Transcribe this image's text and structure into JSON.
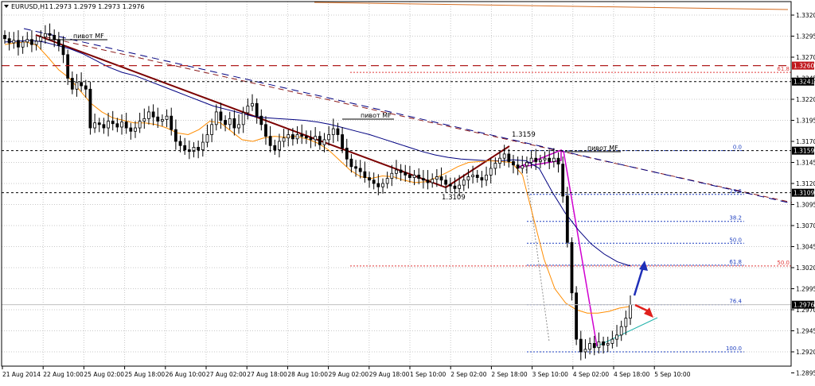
{
  "header": {
    "symbol_label": "EURUSD,H1",
    "ohlc_label": "1.2973 1.2979 1.2973 1.2976"
  },
  "chart_data": {
    "type": "candlestick",
    "symbol": "EURUSD",
    "timeframe": "H1",
    "ohlc_last": {
      "open": 1.2973,
      "high": 1.2979,
      "low": 1.2973,
      "close": 1.2976
    },
    "ylim": [
      1.2895,
      1.3323
    ],
    "grid": true,
    "price_ticks": [
      "1.3320",
      "1.3295",
      "1.3270",
      "1.3245",
      "1.3220",
      "1.3195",
      "1.3170",
      "1.3145",
      "1.3120",
      "1.3095",
      "1.3070",
      "1.3045",
      "1.3020",
      "1.2995",
      "1.2970",
      "1.2945",
      "1.2920",
      "1.2895"
    ],
    "time_ticks": [
      "21 Aug 2014",
      "22 Aug 10:00",
      "25 Aug 02:00",
      "25 Aug 18:00",
      "26 Aug 10:00",
      "27 Aug 02:00",
      "27 Aug 18:00",
      "28 Aug 10:00",
      "29 Aug 02:00",
      "29 Aug 18:00",
      "1 Sep 10:00",
      "2 Sep 02:00",
      "2 Sep 18:00",
      "3 Sep 10:00",
      "4 Sep 02:00",
      "4 Sep 18:00",
      "5 Sep 10:00"
    ],
    "closes": [
      1.3292,
      1.3287,
      1.329,
      1.3282,
      1.3288,
      1.3291,
      1.3285,
      1.3289,
      1.3294,
      1.3298,
      1.3296,
      1.3291,
      1.3284,
      1.3273,
      1.3245,
      1.3232,
      1.324,
      1.3236,
      1.3232,
      1.3186,
      1.3192,
      1.319,
      1.3186,
      1.3194,
      1.3191,
      1.3187,
      1.3193,
      1.3186,
      1.3182,
      1.3186,
      1.3194,
      1.3197,
      1.3205,
      1.3199,
      1.3194,
      1.3196,
      1.32,
      1.3184,
      1.317,
      1.3165,
      1.316,
      1.3158,
      1.3163,
      1.316,
      1.3169,
      1.3178,
      1.319,
      1.3205,
      1.3195,
      1.319,
      1.3197,
      1.3186,
      1.319,
      1.3204,
      1.3212,
      1.3215,
      1.32,
      1.319,
      1.3176,
      1.3165,
      1.316,
      1.317,
      1.3174,
      1.3178,
      1.3173,
      1.3178,
      1.3176,
      1.3174,
      1.3172,
      1.3176,
      1.3166,
      1.3172,
      1.3178,
      1.3185,
      1.3178,
      1.3162,
      1.3149,
      1.314,
      1.3138,
      1.3134,
      1.3127,
      1.3124,
      1.312,
      1.3116,
      1.312,
      1.3126,
      1.3132,
      1.3136,
      1.3133,
      1.313,
      1.3127,
      1.313,
      1.3126,
      1.3124,
      1.3121,
      1.3125,
      1.3128,
      1.3124,
      1.3119,
      1.3117,
      1.3114,
      1.3118,
      1.3124,
      1.3128,
      1.313,
      1.3127,
      1.3124,
      1.313,
      1.3138,
      1.3144,
      1.315,
      1.3155,
      1.3146,
      1.3142,
      1.3138,
      1.3141,
      1.3145,
      1.315,
      1.3146,
      1.3148,
      1.315,
      1.3146,
      1.315,
      1.3143,
      1.3105,
      1.305,
      1.299,
      1.2935,
      1.292,
      1.2923,
      1.293,
      1.2925,
      1.2932,
      1.2928,
      1.293,
      1.2935,
      1.294,
      1.295,
      1.296,
      1.2976
    ],
    "moving_averages": [
      {
        "color": "#000080",
        "values": [
          1.3288,
          1.3289,
          1.329,
          1.3288,
          1.3284,
          1.328,
          1.3274,
          1.3266,
          1.3258,
          1.3252,
          1.3248,
          1.3242,
          1.3236,
          1.323,
          1.3224,
          1.3218,
          1.3212,
          1.3208,
          1.3204,
          1.32,
          1.3198,
          1.3197,
          1.3196,
          1.3195,
          1.3193,
          1.319,
          1.3186,
          1.3182,
          1.3178,
          1.3173,
          1.3168,
          1.3163,
          1.3158,
          1.3154,
          1.3151,
          1.3149,
          1.3148,
          1.3147,
          1.3147,
          1.3148,
          1.3147,
          1.3138,
          1.311,
          1.3085,
          1.3065,
          1.3048,
          1.3036,
          1.3027,
          1.3022
        ]
      },
      {
        "color": "#ff8c00",
        "values": [
          1.3285,
          1.3287,
          1.3288,
          1.3284,
          1.327,
          1.3255,
          1.3245,
          1.323,
          1.3215,
          1.3205,
          1.3198,
          1.3195,
          1.3192,
          1.3192,
          1.319,
          1.3186,
          1.318,
          1.3178,
          1.3184,
          1.3194,
          1.3192,
          1.3182,
          1.3172,
          1.317,
          1.3174,
          1.3176,
          1.3175,
          1.3176,
          1.3173,
          1.3168,
          1.316,
          1.3148,
          1.3136,
          1.3128,
          1.3126,
          1.3129,
          1.3128,
          1.3124,
          1.3121,
          1.3122,
          1.3127,
          1.3133,
          1.314,
          1.3145,
          1.3146,
          1.3147,
          1.3146,
          1.3145,
          1.313,
          1.308,
          1.303,
          1.2995,
          1.2978,
          1.297,
          1.2966,
          1.2966,
          1.2968,
          1.2972,
          1.2974
        ]
      }
    ],
    "price_labels": [
      {
        "value": 1.326,
        "text": "1.3260",
        "bg": "#c0161c",
        "line_color": "#b01e1e",
        "line_dash": "10 6"
      },
      {
        "value": 1.3241,
        "text": "1.3241",
        "bg": "#000000",
        "line_color": "#000000",
        "line_dash": "3 3"
      },
      {
        "value": 1.3159,
        "text": "1.3159",
        "bg": "#000000",
        "line_color": "#000000",
        "line_dash": "3 3"
      },
      {
        "value": 1.3109,
        "text": "1.3109",
        "bg": "#000000",
        "line_color": "#000000",
        "line_dash": "3 3"
      },
      {
        "value": 1.2976,
        "text": "1.2976",
        "bg": "#000000",
        "line_color": "#c0c0c0",
        "line_dash": ""
      }
    ],
    "annotations": [
      {
        "text": "пивот МF"
      },
      {
        "text": "пивот МF"
      },
      {
        "text": "пивот МF"
      },
      {
        "text": "1.3159",
        "value": 1.3159
      },
      {
        "text": "1.3109",
        "value": 1.3109
      }
    ],
    "fibonacci_small": [
      {
        "level": "0.0",
        "value": 1.3159
      },
      {
        "level": "23.6",
        "value": 1.3107
      },
      {
        "level": "38.2",
        "value": 1.3075
      },
      {
        "level": "50.0",
        "value": 1.3049
      },
      {
        "level": "61.8",
        "value": 1.3023
      },
      {
        "level": "76.4",
        "value": 1.2976
      },
      {
        "level": "100.0",
        "value": 1.292
      }
    ],
    "fibonacci_large": [
      {
        "level": "61.8",
        "value": 1.3252
      },
      {
        "level": "50.0",
        "value": 1.3022
      }
    ],
    "scenario_arrows": [
      {
        "direction": "up",
        "color": "#1f2fb8"
      },
      {
        "direction": "down",
        "color": "#e0201c"
      }
    ]
  }
}
